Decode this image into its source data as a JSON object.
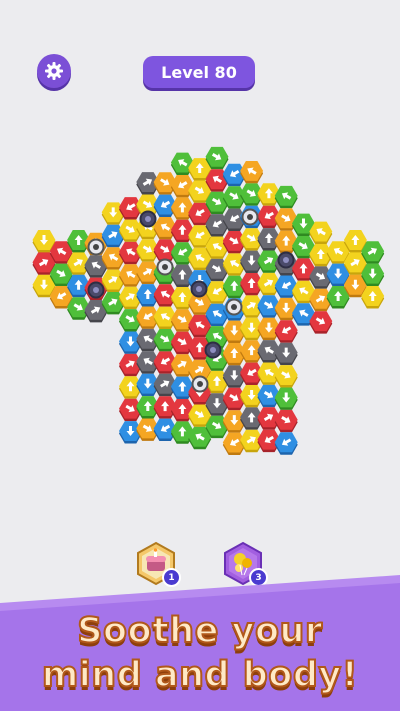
{
  "header": {
    "settings_icon": "gear-icon",
    "level_label": "Level 80"
  },
  "colors": {
    "background": "#ececef",
    "accent": "#7e55df",
    "red": "#e3373f",
    "orange": "#f5a623",
    "yellow": "#f3d31e",
    "green": "#4fbf3a",
    "blue": "#2f8fe3",
    "gray": "#6a6a72",
    "empty": "#cfcfd6"
  },
  "boosters": [
    {
      "name": "cake-booster-icon",
      "count": "1"
    },
    {
      "name": "balloon-booster-icon",
      "count": "3"
    }
  ],
  "slogan": {
    "line1": "Soothe your",
    "line2": "mind and body!"
  }
}
